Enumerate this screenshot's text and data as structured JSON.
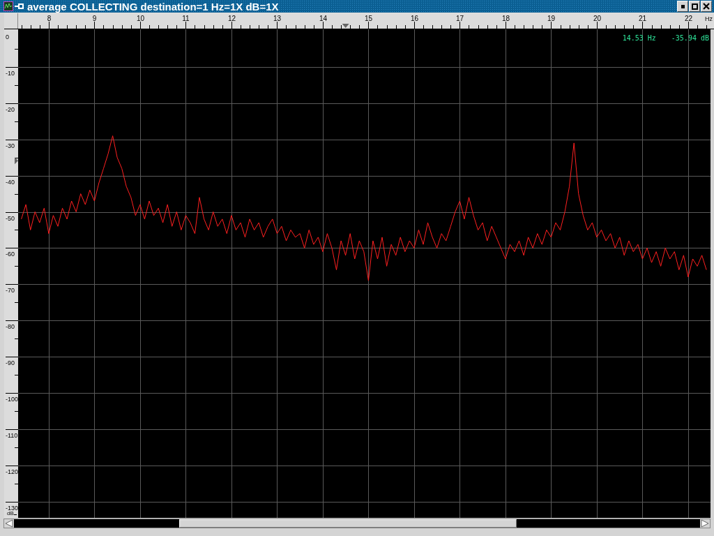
{
  "window": {
    "title": "average COLLECTING destination=1 Hz=1X dB=1X"
  },
  "readout": {
    "frequency": "14.53 Hz",
    "level": "-35.94 dB"
  },
  "spectrum": {
    "chart_data": {
      "type": "line",
      "xlabel": "Hz",
      "grid": true,
      "ylabel": "dB",
      "xlim": [
        7.33,
        22.49
      ],
      "ylim": [
        -134.5,
        0.4
      ],
      "xticks": [
        8,
        9,
        10,
        11,
        12,
        13,
        14,
        15,
        16,
        17,
        18,
        19,
        20,
        21,
        22
      ],
      "yticks": [
        0,
        -10,
        -20,
        -30,
        -40,
        -50,
        -60,
        -70,
        -80,
        -90,
        -100,
        -110,
        -120,
        -130
      ],
      "x": [
        7.4,
        7.5,
        7.6,
        7.7,
        7.8,
        7.9,
        8.0,
        8.1,
        8.2,
        8.3,
        8.4,
        8.5,
        8.6,
        8.7,
        8.8,
        8.9,
        9.0,
        9.1,
        9.2,
        9.3,
        9.4,
        9.5,
        9.6,
        9.7,
        9.8,
        9.9,
        10.0,
        10.1,
        10.2,
        10.3,
        10.4,
        10.5,
        10.6,
        10.7,
        10.8,
        10.9,
        11.0,
        11.1,
        11.2,
        11.3,
        11.4,
        11.5,
        11.6,
        11.7,
        11.8,
        11.9,
        12.0,
        12.1,
        12.2,
        12.3,
        12.4,
        12.5,
        12.6,
        12.7,
        12.8,
        12.9,
        13.0,
        13.1,
        13.2,
        13.3,
        13.4,
        13.5,
        13.6,
        13.7,
        13.8,
        13.9,
        14.0,
        14.1,
        14.2,
        14.3,
        14.4,
        14.5,
        14.6,
        14.7,
        14.8,
        14.9,
        15.0,
        15.1,
        15.2,
        15.3,
        15.4,
        15.5,
        15.6,
        15.7,
        15.8,
        15.9,
        16.0,
        16.1,
        16.2,
        16.3,
        16.4,
        16.5,
        16.6,
        16.7,
        16.8,
        16.9,
        17.0,
        17.1,
        17.2,
        17.3,
        17.4,
        17.5,
        17.6,
        17.7,
        17.8,
        17.9,
        18.0,
        18.1,
        18.2,
        18.3,
        18.4,
        18.5,
        18.6,
        18.7,
        18.8,
        18.9,
        19.0,
        19.1,
        19.2,
        19.3,
        19.4,
        19.5,
        19.6,
        19.7,
        19.8,
        19.9,
        20.0,
        20.1,
        20.2,
        20.3,
        20.4,
        20.5,
        20.6,
        20.7,
        20.8,
        20.9,
        21.0,
        21.1,
        21.2,
        21.3,
        21.4,
        21.5,
        21.6,
        21.7,
        21.8,
        21.9,
        22.0,
        22.1,
        22.2,
        22.3,
        22.4
      ],
      "series": [
        {
          "color": "#ff2020",
          "values": [
            -52,
            -48,
            -55,
            -50,
            -53,
            -49,
            -56,
            -51,
            -54,
            -49,
            -52,
            -47,
            -50,
            -45,
            -48,
            -44,
            -47,
            -42,
            -38,
            -34,
            -29,
            -35,
            -38,
            -43,
            -46,
            -51,
            -48,
            -52,
            -47,
            -51,
            -49,
            -53,
            -48,
            -54,
            -50,
            -55,
            -51,
            -53,
            -56,
            -46,
            -52,
            -55,
            -50,
            -54,
            -52,
            -56,
            -51,
            -55,
            -53,
            -57,
            -52,
            -55,
            -53,
            -57,
            -54,
            -52,
            -56,
            -54,
            -58,
            -55,
            -57,
            -56,
            -60,
            -55,
            -59,
            -57,
            -61,
            -56,
            -60,
            -66,
            -58,
            -62,
            -56,
            -63,
            -58,
            -61,
            -69,
            -58,
            -63,
            -57,
            -65,
            -59,
            -62,
            -57,
            -61,
            -58,
            -60,
            -55,
            -59,
            -53,
            -57,
            -60,
            -56,
            -58,
            -54,
            -50,
            -47,
            -52,
            -46,
            -51,
            -55,
            -53,
            -58,
            -54,
            -57,
            -60,
            -63,
            -59,
            -61,
            -58,
            -62,
            -57,
            -60,
            -56,
            -59,
            -55,
            -57,
            -53,
            -55,
            -50,
            -43,
            -31,
            -45,
            -51,
            -55,
            -53,
            -57,
            -55,
            -58,
            -56,
            -60,
            -57,
            -62,
            -58,
            -61,
            -59,
            -63,
            -60,
            -64,
            -61,
            -65,
            -60,
            -63,
            -61,
            -66,
            -62,
            -68,
            -63,
            -65,
            -62,
            -66
          ]
        }
      ]
    }
  }
}
